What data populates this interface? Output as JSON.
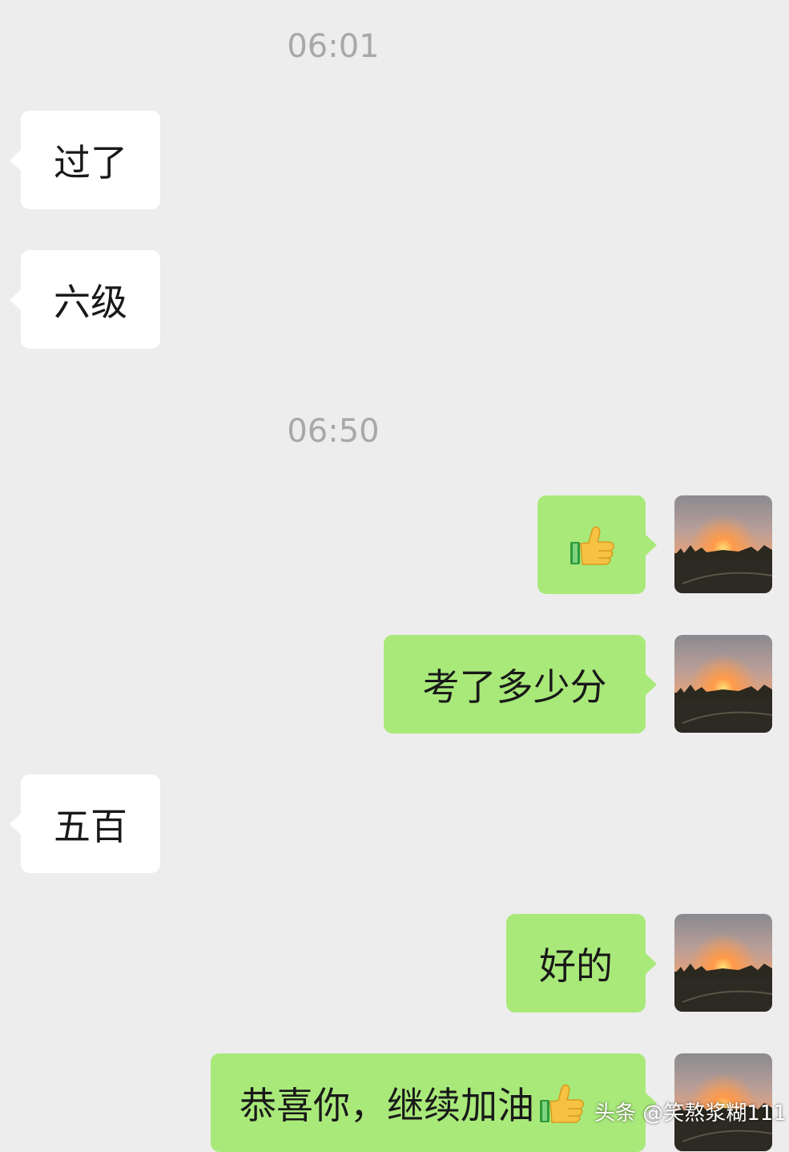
{
  "timestamps": {
    "t1": "06:01",
    "t2": "06:50"
  },
  "messages": [
    {
      "side": "incoming",
      "text": "过了"
    },
    {
      "side": "incoming",
      "text": "六级"
    },
    {
      "side": "outgoing",
      "text": "",
      "icon": "thumbs-up-icon"
    },
    {
      "side": "outgoing",
      "text": "考了多少分"
    },
    {
      "side": "incoming",
      "text": "五百"
    },
    {
      "side": "outgoing",
      "text": "好的"
    },
    {
      "side": "outgoing",
      "text": "恭喜你，继续加油",
      "icon": "thumbs-up-icon"
    }
  ],
  "watermark": "头条 @笑熬浆糊111",
  "colors": {
    "background": "#ededed",
    "incoming_bubble": "#ffffff",
    "outgoing_bubble": "#a9e97a",
    "timestamp": "#a8a8a8"
  }
}
